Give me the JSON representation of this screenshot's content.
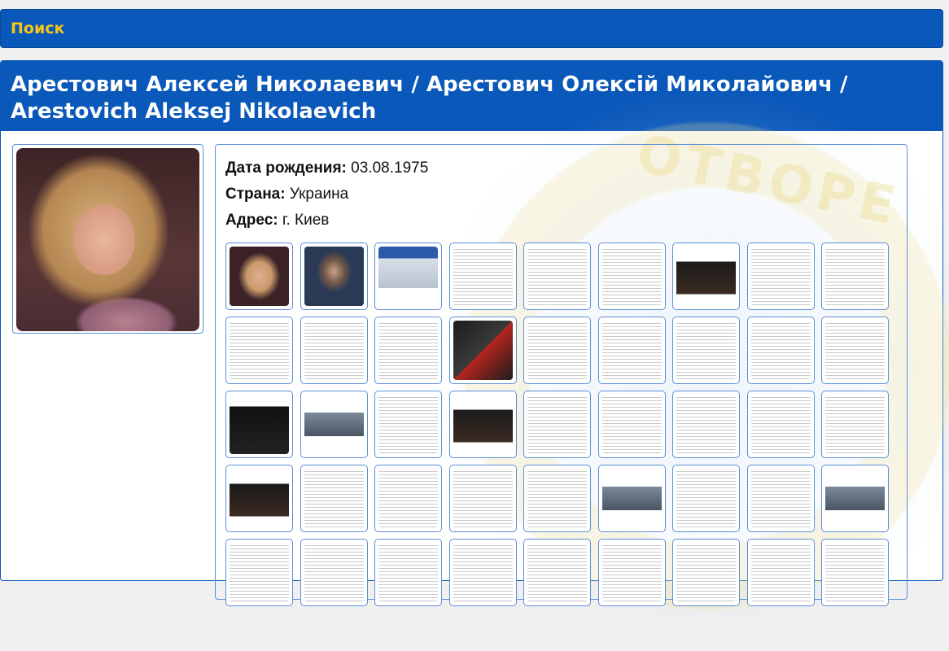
{
  "nav": {
    "search_label": "Поиск"
  },
  "profile": {
    "title": "Арестович Алексей Николаевич / Арестович Олексій Миколайович / Arestovich Aleksej Nikolaevich",
    "birth_label": "Дата рождения:",
    "birth_value": "03.08.1975",
    "country_label": "Страна:",
    "country_value": "Украина",
    "address_label": "Адрес:",
    "address_value": "г. Киев"
  },
  "colors": {
    "header_bg": "#0a58ba",
    "search_text": "#f5c518",
    "border": "#5b8fd6"
  },
  "evidence_thumbnails": [
    "photo1",
    "photo2",
    "photo3",
    "doc",
    "doc",
    "doc",
    "dark",
    "doc",
    "doc",
    "doc",
    "doc",
    "doc",
    "krah",
    "doc",
    "doc",
    "doc",
    "doc",
    "doc",
    "black",
    "news",
    "doc",
    "dark",
    "doc",
    "doc",
    "doc",
    "doc",
    "doc",
    "dark",
    "doc",
    "doc",
    "doc",
    "doc",
    "news",
    "doc",
    "doc",
    "news",
    "doc",
    "doc",
    "doc",
    "doc",
    "doc",
    "doc",
    "doc",
    "doc",
    "doc"
  ]
}
